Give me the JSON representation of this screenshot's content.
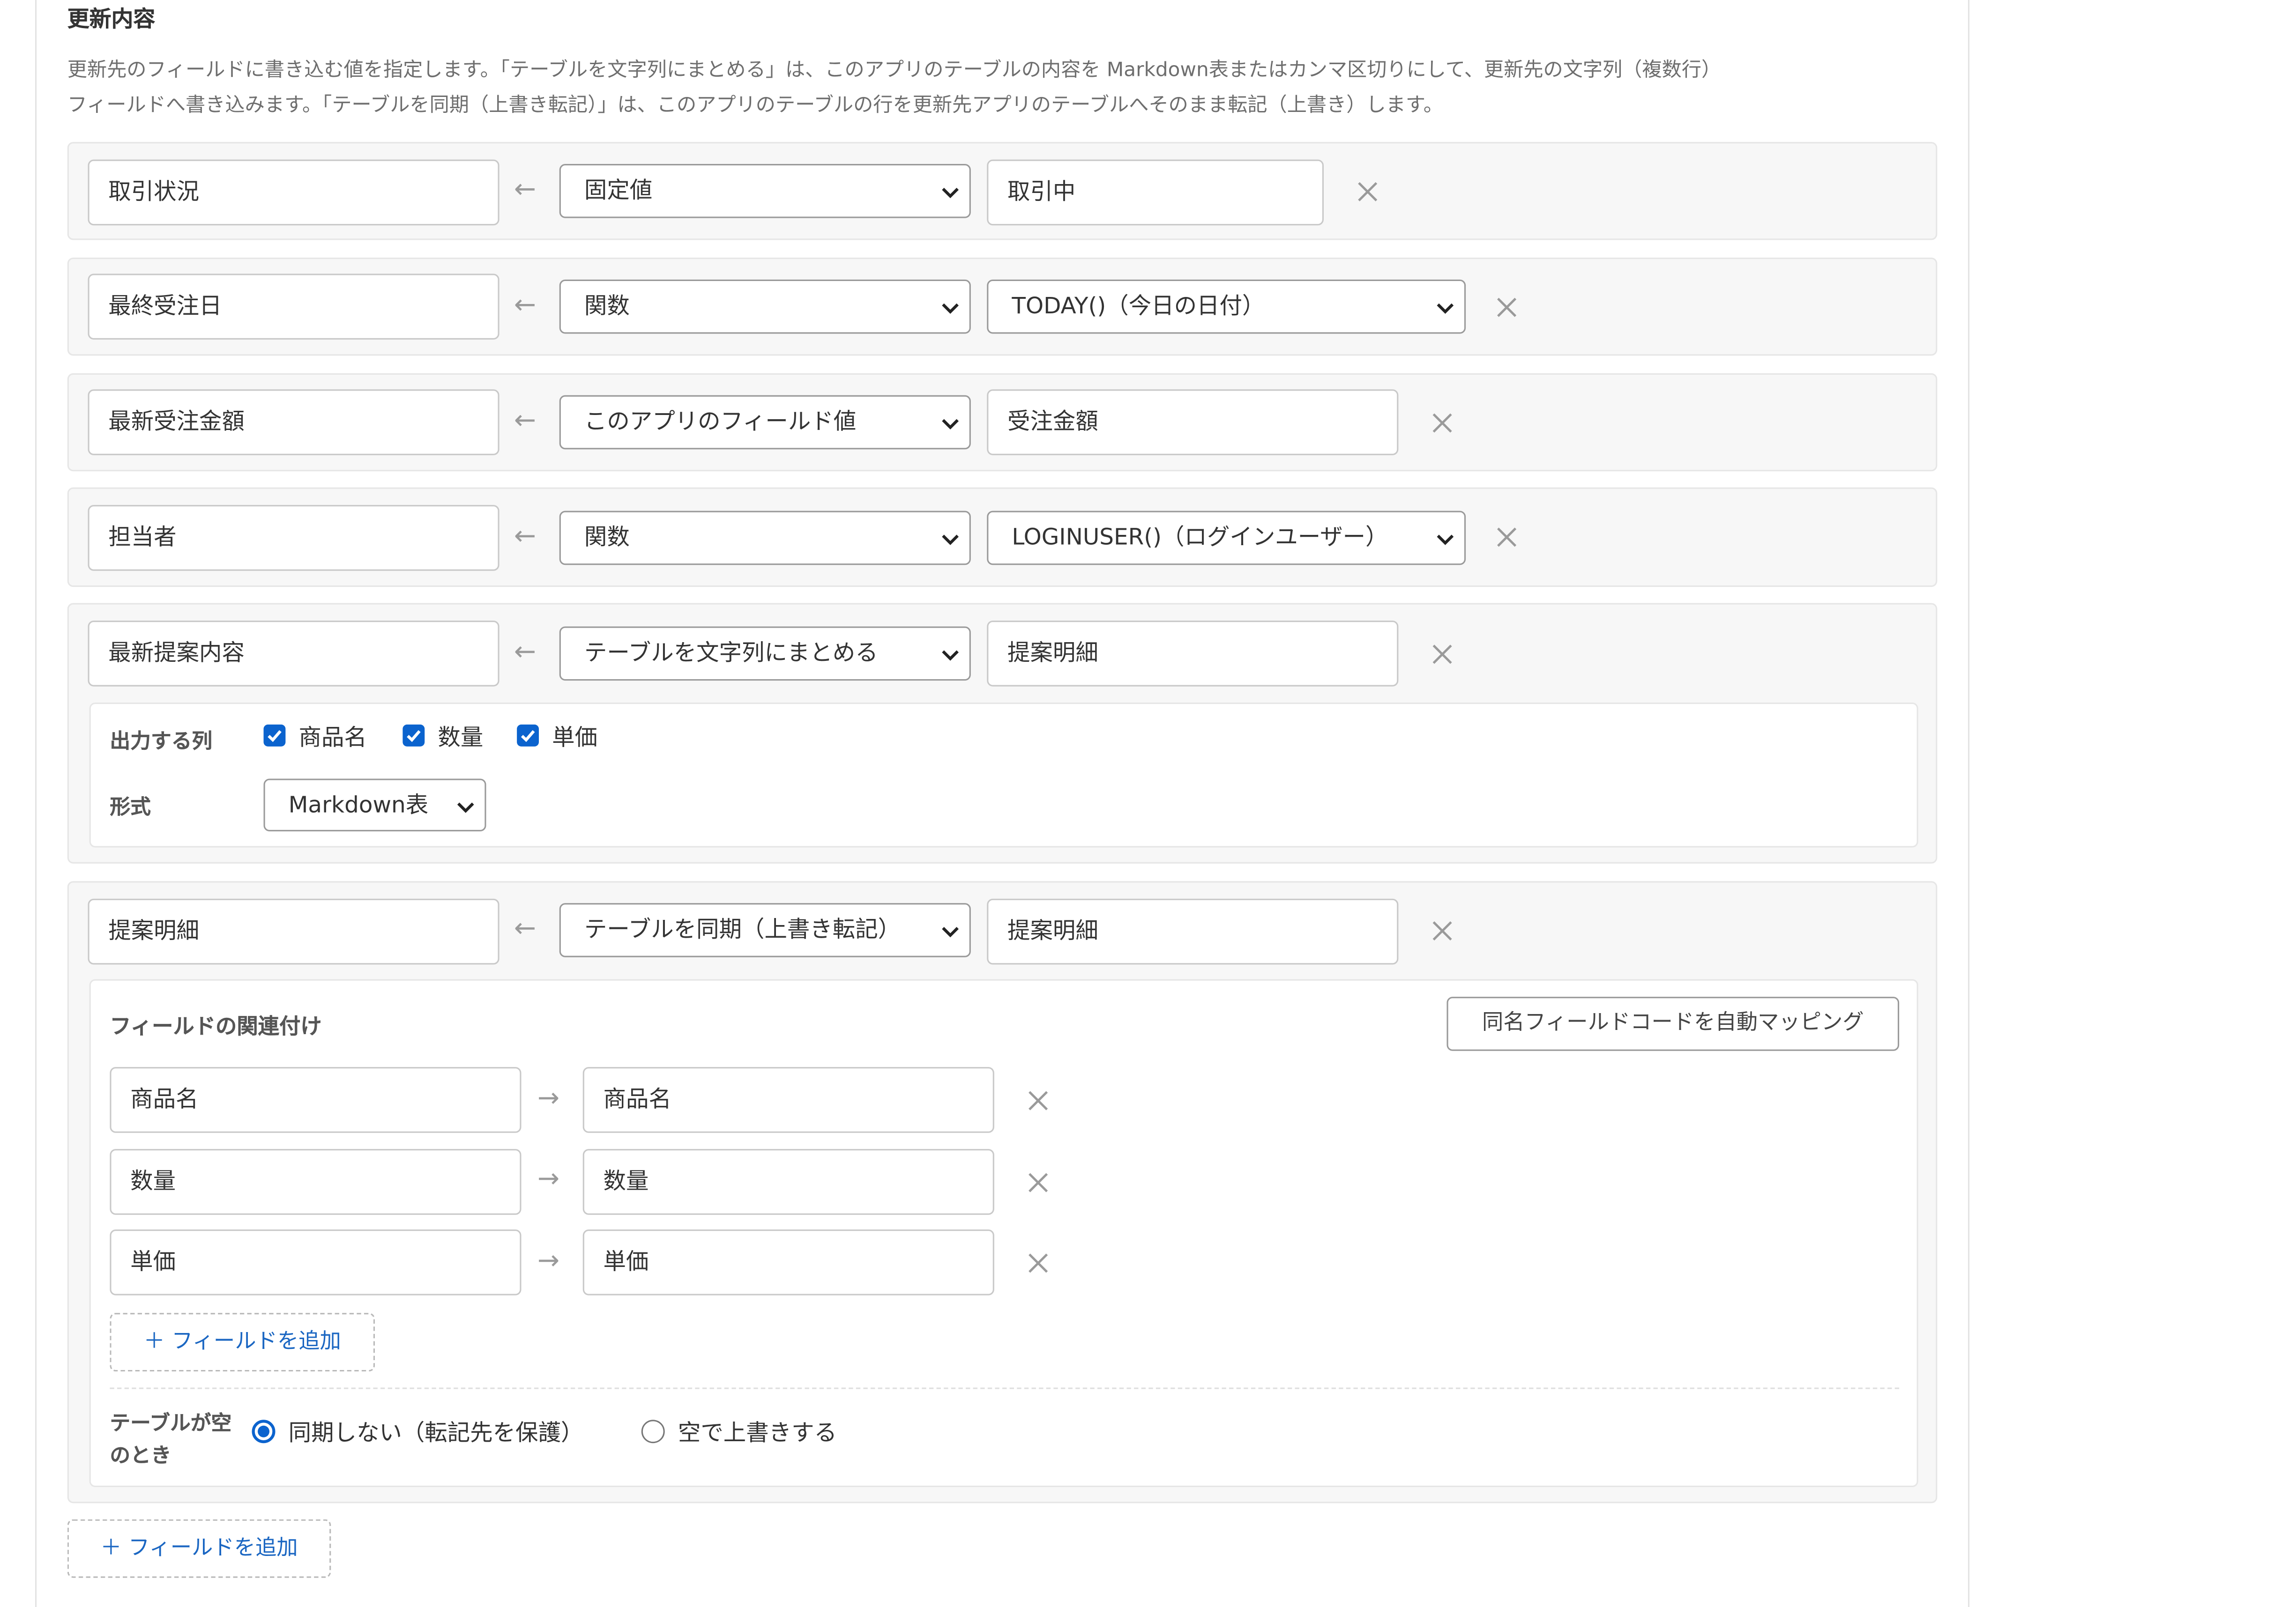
{
  "section": {
    "title": "更新内容",
    "description_line1": "更新先のフィールドに書き込む値を指定します。「テーブルを文字列にまとめる」は、このアプリのテーブルの内容を Markdown表またはカンマ区切りにして、更新先の文字列（複数行）",
    "description_line2": "フィールドへ書き込みます。「テーブルを同期（上書き転記）」は、このアプリのテーブルの行を更新先アプリのテーブルへそのまま転記（上書き）します。"
  },
  "rows": [
    {
      "target": "取引状況",
      "arrow": "←",
      "type": "固定値",
      "value": "取引中"
    },
    {
      "target": "最終受注日",
      "arrow": "←",
      "type": "関数",
      "value": "TODAY()（今日の日付）"
    },
    {
      "target": "最新受注金額",
      "arrow": "←",
      "type": "このアプリのフィールド値",
      "value": "受注金額"
    },
    {
      "target": "担当者",
      "arrow": "←",
      "type": "関数",
      "value": "LOGINUSER()（ログインユーザー）"
    },
    {
      "target": "最新提案内容",
      "arrow": "←",
      "type": "テーブルを文字列にまとめる",
      "value": "提案明細"
    },
    {
      "target": "提案明細",
      "arrow": "←",
      "type": "テーブルを同期（上書き転記）",
      "value": "提案明細"
    }
  ],
  "string_options": {
    "columns_label": "出力する列",
    "columns": [
      {
        "label": "商品名",
        "checked": true
      },
      {
        "label": "数量",
        "checked": true
      },
      {
        "label": "単価",
        "checked": true
      }
    ],
    "format_label": "形式",
    "format_value": "Markdown表"
  },
  "sync_options": {
    "mapping_title": "フィールドの関連付け",
    "auto_map_button": "同名フィールドコードを自動マッピング",
    "mappings": [
      {
        "source": "商品名",
        "arrow": "→",
        "dest": "商品名"
      },
      {
        "source": "数量",
        "arrow": "→",
        "dest": "数量"
      },
      {
        "source": "単価",
        "arrow": "→",
        "dest": "単価"
      }
    ],
    "add_field_button": "＋ フィールドを追加",
    "empty_label_line1": "テーブルが空",
    "empty_label_line2": "のとき",
    "empty_options": [
      {
        "label": "同期しない（転記先を保護）",
        "selected": true
      },
      {
        "label": "空で上書きする",
        "selected": false
      }
    ]
  },
  "add_field_button": "＋ フィールドを追加",
  "colors": {
    "accent": "#0b63ce",
    "link": "#1a66c2",
    "row_bg": "#f7f7f7"
  },
  "icons": {
    "remove": "close-icon",
    "dropdown": "chevron-down-icon",
    "checkbox": "check-icon"
  }
}
